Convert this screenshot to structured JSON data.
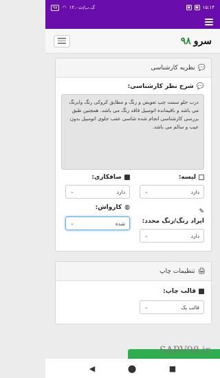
{
  "status_bar": {
    "time": "۱۵:۱۴",
    "network": "۱۲،۰ک.ب/ث",
    "battery": "۹۷"
  },
  "navbar": {
    "brand_text": "سرو",
    "brand_number": "۹۸"
  },
  "expert_panel": {
    "header": "نظریه کارشناسی",
    "comment_title": "شرح نظر کارشناسی:",
    "comment_text": "درب جلو سمت چپ تعویض و رنگ و مطابق کروکی رنگ وابرنگ می باشد و باقیمانده اتومبیل فاقد رنگ می باشد. همچنین طبق بررسی کارشناسی انجام شده شاسی عقب جلوی اتومبیل بدون عیب و سالم می باشد.",
    "fields": {
      "lise": {
        "label": "لیسه:",
        "value": "دارد"
      },
      "safkari": {
        "label": "صافکاری:",
        "value": "دارد"
      },
      "iradrang": {
        "label": "ایراد رنگ/رنگ مجدد:",
        "value": "دارد"
      },
      "karvash": {
        "label": "کارواش:",
        "value": "شده"
      }
    }
  },
  "print_panel": {
    "header": "تنظیمات چاپ",
    "template_label": "قالب چاپ:",
    "template_value": "قالب یک"
  },
  "watermark": "SARV98.ir",
  "bottom_nav": {
    "icons": [
      "back-icon",
      "home-icon",
      "recent-icon"
    ]
  }
}
